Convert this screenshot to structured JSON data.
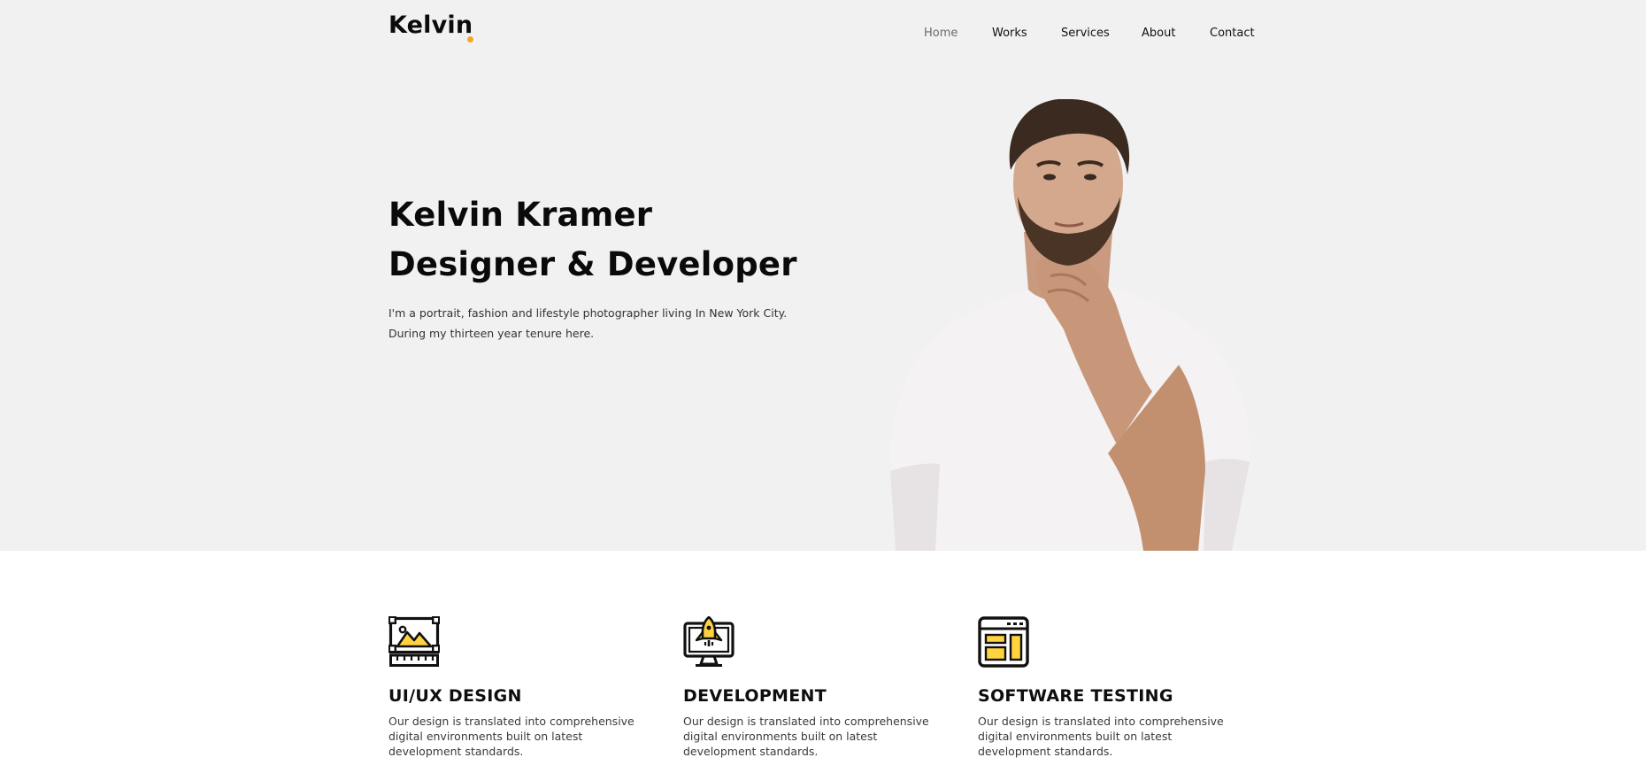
{
  "brand": {
    "name": "Kelvin",
    "accent_color": "#f5a623"
  },
  "nav": {
    "items": [
      {
        "label": "Home",
        "active": true
      },
      {
        "label": "Works",
        "active": false
      },
      {
        "label": "Services",
        "active": false
      },
      {
        "label": "About",
        "active": false
      },
      {
        "label": "Contact",
        "active": false
      }
    ]
  },
  "hero": {
    "title_line1": "Kelvin Kramer",
    "title_line2": "Designer & Developer",
    "desc_line1": "I'm a portrait, fashion and lifestyle photographer living In New York City.",
    "desc_line2": "During my thirteen year tenure here.",
    "image": "portrait-photo"
  },
  "services": [
    {
      "icon": "design-frame-icon",
      "title": "UI/UX DESIGN",
      "desc": "Our design is translated into comprehensive digital environments built on latest development standards."
    },
    {
      "icon": "monitor-rocket-icon",
      "title": "DEVELOPMENT",
      "desc": "Our design is translated into comprehensive digital environments built on latest development standards."
    },
    {
      "icon": "browser-layout-icon",
      "title": "SOFTWARE TESTING",
      "desc": "Our design is translated into comprehensive digital environments built on latest development standards."
    }
  ]
}
